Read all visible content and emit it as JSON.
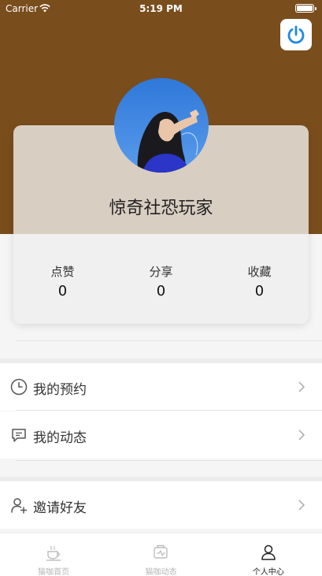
{
  "status_bar": {
    "carrier": "Carrier",
    "time": "5:19 PM"
  },
  "colors": {
    "header": "#7a4d1d",
    "accent": "#1e88e5",
    "card_top": "#d9cec2"
  },
  "profile": {
    "username": "惊奇社恐玩家",
    "avatar": "avatar-photo",
    "stats": [
      {
        "label": "点赞",
        "value": "0"
      },
      {
        "label": "分享",
        "value": "0"
      },
      {
        "label": "收藏",
        "value": "0"
      }
    ]
  },
  "menu": [
    {
      "label": "我的预约",
      "icon": "clock-icon"
    },
    {
      "label": "我的动态",
      "icon": "message-icon"
    },
    {
      "label": "邀请好友",
      "icon": "add-user-icon"
    }
  ],
  "tabs": [
    {
      "label": "猫咖首页",
      "icon": "coffee-icon",
      "active": false
    },
    {
      "label": "猫咖动态",
      "icon": "activity-icon",
      "active": false
    },
    {
      "label": "个人中心",
      "icon": "user-icon",
      "active": true
    }
  ]
}
